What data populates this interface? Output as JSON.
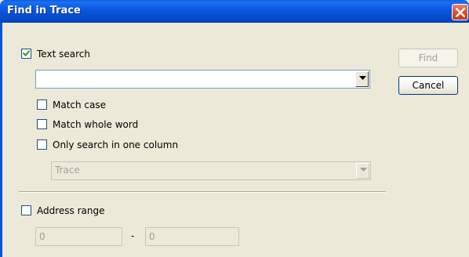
{
  "window": {
    "title": "Find in Trace"
  },
  "options": {
    "text_search": {
      "label": "Text search",
      "checked": true
    },
    "search_value": "",
    "match_case": {
      "label": "Match case",
      "checked": false
    },
    "match_whole_word": {
      "label": "Match whole word",
      "checked": false
    },
    "only_one_column": {
      "label": "Only search in one column",
      "checked": false
    },
    "column_value": "Trace"
  },
  "buttons": {
    "find": "Find",
    "cancel": "Cancel"
  },
  "address_range": {
    "label": "Address range",
    "checked": false,
    "from": "0",
    "separator": "-",
    "to": "0"
  }
}
